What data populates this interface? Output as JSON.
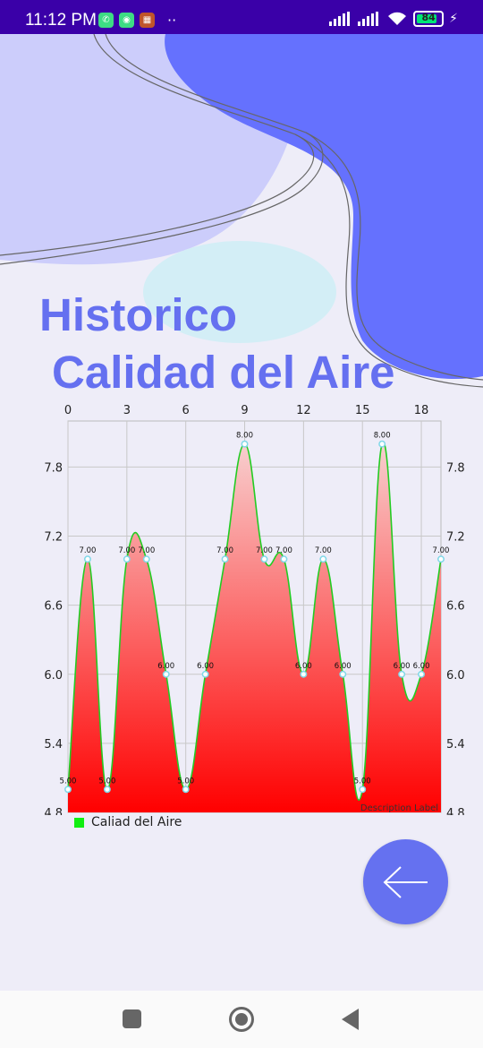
{
  "status_bar": {
    "time": "11:12 PM",
    "battery": "84"
  },
  "page": {
    "title_line1": "Historico",
    "title_line2": "Calidad del Aire"
  },
  "colors": {
    "accent": "#6571f0",
    "status_bar": "#3a00a8",
    "line": "#22cc22",
    "fill_bottom": "#ff0000"
  },
  "chart_data": {
    "type": "area",
    "x": [
      0,
      1,
      2,
      3,
      4,
      5,
      6,
      7,
      8,
      9,
      10,
      11,
      12,
      13,
      14,
      15,
      16,
      17,
      18,
      19
    ],
    "series": [
      {
        "name": "Caliad del Aire",
        "values": [
          5,
          7,
          5,
          7,
          7,
          6,
          5,
          6,
          7,
          8,
          7,
          7,
          6,
          7,
          6,
          5,
          8,
          6,
          6,
          7
        ]
      }
    ],
    "point_labels": [
      "5.00",
      "7.00",
      "5.00",
      "7.00",
      "7.00",
      "6.00",
      "5.00",
      "6.00",
      "7.00",
      "8.00",
      "7.00",
      "7.00",
      "6.00",
      "7.00",
      "6.00",
      "5.00",
      "8.00",
      "6.00",
      "6.00",
      "7.00"
    ],
    "x_ticks": [
      "0",
      "3",
      "6",
      "9",
      "12",
      "15",
      "18"
    ],
    "y_ticks": [
      "4.8",
      "5.4",
      "6.0",
      "6.6",
      "7.2",
      "7.8"
    ],
    "ylim": [
      4.8,
      8.2
    ],
    "xlim": [
      0,
      19
    ],
    "description": "Description Label",
    "grid": true,
    "legend_position": "bottom-left"
  },
  "icons": {
    "fab": "arrow-left-icon",
    "nav_back": "square-icon",
    "nav_home": "circle-icon",
    "nav_recent": "triangle-icon"
  }
}
